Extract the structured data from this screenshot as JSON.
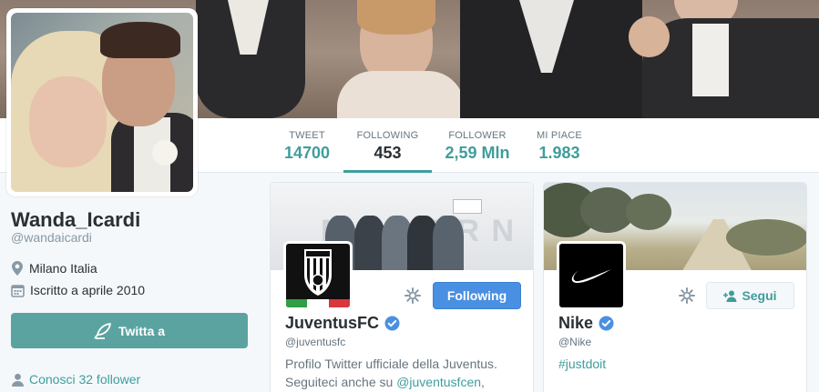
{
  "colors": {
    "accent": "#3f9d9c",
    "button_tweet": "#5ba3a1",
    "following_btn": "#4a90e2",
    "verified": "#4a90e2",
    "juve_flag": [
      "#2f9e44",
      "#ffffff",
      "#d9363e"
    ]
  },
  "nav": [
    {
      "label": "TWEET",
      "value": "14700"
    },
    {
      "label": "FOLLOWING",
      "value": "453",
      "active": true
    },
    {
      "label": "FOLLOWER",
      "value": "2,59 Mln"
    },
    {
      "label": "MI PIACE",
      "value": "1.983"
    }
  ],
  "profile": {
    "name": "Wanda_Icardi",
    "handle": "@wandaicardi",
    "location": "Milano Italia",
    "joined": "Iscritto a aprile 2010",
    "tweet_to_label": "Twitta a",
    "followers_you_know": "Conosci 32 follower",
    "location_icon": "map-pin-icon",
    "joined_icon": "calendar-icon"
  },
  "cards": {
    "juventus": {
      "name": "JuventusFC",
      "handle": "@juventusfc",
      "verified": true,
      "button_label": "Following",
      "bio_prefix": "Profilo Twitter ufficiale della Juventus. Seguiteci anche su ",
      "bio_link": "@juventusfcen",
      "bio_suffix": ","
    },
    "nike": {
      "name": "Nike",
      "handle": "@Nike",
      "verified": true,
      "button_label": "Segui",
      "bio_link": "#justdoit"
    }
  }
}
